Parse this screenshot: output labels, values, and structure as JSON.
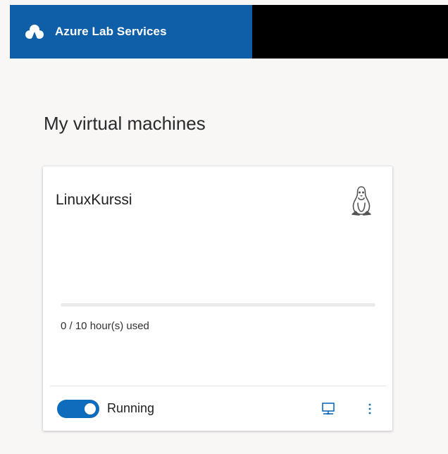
{
  "app": {
    "title": "Azure Lab Services",
    "brand_icon": "azure-lab-cloud-icon",
    "colors": {
      "brand_blue": "#0f5fa8",
      "header_black": "#000000",
      "accent": "#0f6cbd",
      "page_background": "#f8f7f6"
    }
  },
  "page": {
    "title": "My virtual machines"
  },
  "vm_cards": [
    {
      "name": "LinuxKurssi",
      "os_icon": "linux-penguin-icon",
      "usage": {
        "used_hours": 0,
        "quota_hours": 10,
        "fraction_used": 0,
        "label": "0 / 10 hour(s) used"
      },
      "state": {
        "toggle_on": true,
        "label": "Running"
      },
      "actions": {
        "connect_icon": "connect-monitor-icon",
        "more_icon": "more-vertical-icon"
      }
    }
  ]
}
